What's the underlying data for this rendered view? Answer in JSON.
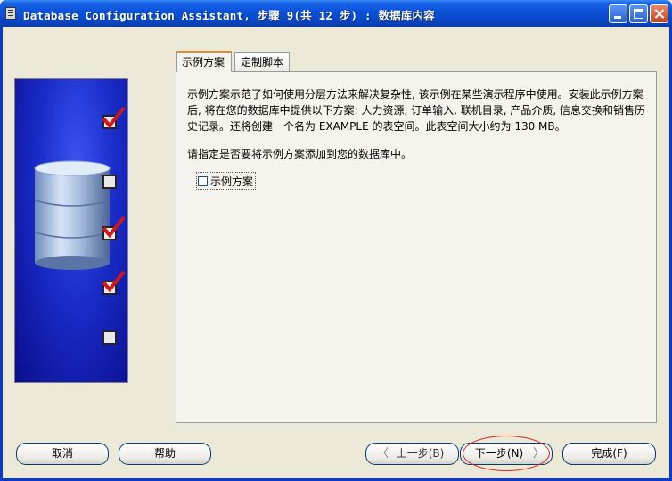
{
  "window": {
    "title": "Database Configuration Assistant, 步骤 9(共 12 步) : 数据库内容"
  },
  "tabs": [
    {
      "label": "示例方案",
      "active": true
    },
    {
      "label": "定制脚本",
      "active": false
    }
  ],
  "content": {
    "description_lines": [
      "示例方案示范了如何使用分层方法来解决复杂性, 该示例在某些演示程序中使用。安装此示例方案",
      "后, 将在您的数据库中提供以下方案: 人力资源, 订单输入, 联机目录, 产品介质, 信息交换和销售历",
      "史记录。还将创建一个名为 EXAMPLE 的表空间。此表空间大小约为 130 MB。"
    ],
    "prompt": "请指定是否要将示例方案添加到您的数据库中。",
    "checkbox": {
      "label": "示例方案",
      "checked": false
    }
  },
  "side_panel": {
    "steps": [
      "checked",
      "unchecked",
      "checked",
      "checked",
      "unchecked"
    ]
  },
  "buttons": {
    "cancel": "取消",
    "help": "帮助",
    "back": "上一步(B)",
    "next": "下一步(N)",
    "finish": "完成(F)"
  },
  "colors": {
    "titlebar": "#0A51D8",
    "panel_blue": "#1A2BC8",
    "highlight_ellipse": "#D8261E",
    "check_red": "#D01818"
  }
}
